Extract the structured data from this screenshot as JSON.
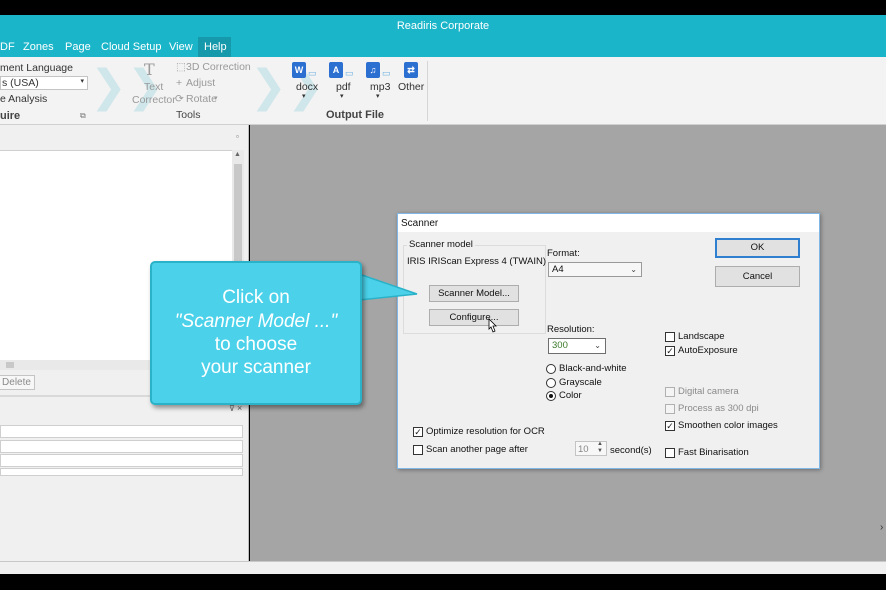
{
  "window": {
    "title": "Readiris Corporate"
  },
  "menu": {
    "items": [
      "DF",
      "Zones",
      "Page",
      "Cloud Setup",
      "View",
      "Help"
    ]
  },
  "ribbon": {
    "acquire": {
      "language_label": "ment Language",
      "language_value": "s (USA)",
      "analysis_label": "e Analysis",
      "group_label": "uire"
    },
    "tools": {
      "text_corrector_line1": "Text",
      "text_corrector_line2": "Corrector",
      "correction_3d": "3D Correction",
      "adjust": "Adjust",
      "rotate": "Rotate",
      "group_label": "Tools"
    },
    "output": {
      "docx": "docx",
      "pdf": "pdf",
      "mp3": "mp3",
      "other": "Other",
      "group_label": "Output File"
    }
  },
  "left_panel": {
    "delete_label": "Delete"
  },
  "dialog": {
    "title": "Scanner",
    "scanner_model_label": "Scanner model",
    "scanner_name": "IRIS IRIScan Express 4 (TWAIN)",
    "scanner_model_button": "Scanner Model...",
    "configure_button": "Configure...",
    "format_label": "Format:",
    "format_value": "A4",
    "resolution_label": "Resolution:",
    "resolution_value": "300",
    "color_modes": [
      "Black-and-white",
      "Grayscale",
      "Color"
    ],
    "selected_color_mode": "Color",
    "landscape": "Landscape",
    "auto_exposure": "AutoExposure",
    "digital_camera": "Digital camera",
    "process_300": "Process as 300 dpi",
    "smoothen": "Smoothen color images",
    "fast_binarisation": "Fast Binarisation",
    "optimize_resolution": "Optimize resolution for OCR",
    "scan_another": "Scan another page after",
    "seconds_value": "10",
    "seconds_unit": "second(s)",
    "ok_button": "OK",
    "cancel_button": "Cancel"
  },
  "callout": {
    "line1": "Click on",
    "line2": "\"Scanner Model ...\"",
    "line3": "to choose",
    "line4": "your scanner"
  },
  "colors": {
    "accent": "#1bb5c9",
    "callout": "#4bd2ea",
    "canvas": "#a5a5a5"
  }
}
